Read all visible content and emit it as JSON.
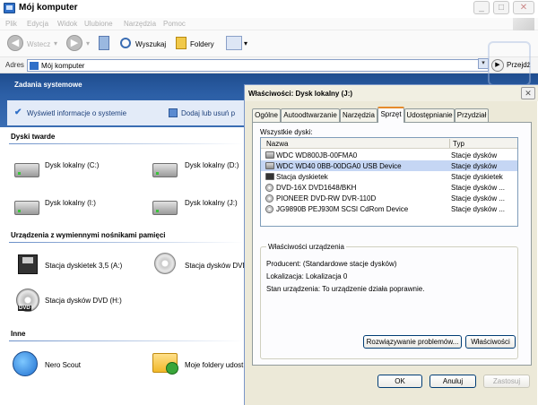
{
  "window": {
    "title": "Mój komputer"
  },
  "menu": [
    "Plik",
    "Edycja",
    "Widok",
    "Ulubione",
    "Narzędzia",
    "Pomoc"
  ],
  "toolbar": {
    "back": "Wstecz",
    "search": "Wyszukaj",
    "folders": "Foldery"
  },
  "address": {
    "label": "Adres",
    "value": "Mój komputer",
    "go": "Przejdź"
  },
  "tasks": {
    "title": "Zadania systemowe",
    "items": [
      "Wyświetl informacje o systemie",
      "Dodaj lub usuń p"
    ]
  },
  "sections": {
    "hard_disks": {
      "title": "Dyski twarde",
      "items": [
        "Dysk lokalny (C:)",
        "Dysk lokalny (D:)",
        "Dysk lokalny (I:)",
        "Dysk lokalny (J:)"
      ]
    },
    "removable": {
      "title": "Urządzenia z wymiennymi nośnikami pamięci",
      "items": [
        "Stacja dyskietek 3,5 (A:)",
        "Stacja dysków DVD",
        "Stacja dysków DVD (H:)"
      ]
    },
    "other": {
      "title": "Inne",
      "items": [
        "Nero Scout",
        "Moje foldery udost"
      ]
    }
  },
  "dialog": {
    "title": "Właściwości: Dysk lokalny (J:)",
    "tabs": [
      "Ogólne",
      "Autoodtwarzanie",
      "Narzędzia",
      "Sprzęt",
      "Udostępnianie",
      "Przydział"
    ],
    "active_tab": "Sprzęt",
    "all_disks_label": "Wszystkie dyski:",
    "columns": {
      "name": "Nazwa",
      "type": "Typ"
    },
    "disks": [
      {
        "name": "WDC WD800JB-00FMA0",
        "type": "Stacje dysków",
        "icon": "hdd"
      },
      {
        "name": "WDC WD40 0BB-00DGA0 USB Device",
        "type": "Stacje dysków",
        "icon": "hdd"
      },
      {
        "name": "Stacja dyskietek",
        "type": "Stacje dyskietek",
        "icon": "floppy"
      },
      {
        "name": "DVD-16X DVD1648/BKH",
        "type": "Stacje dysków ...",
        "icon": "cd"
      },
      {
        "name": "PIONEER DVD-RW  DVR-110D",
        "type": "Stacje dysków ...",
        "icon": "cd"
      },
      {
        "name": "JG9890B PEJ930M SCSI CdRom Device",
        "type": "Stacje dysków ...",
        "icon": "cd"
      }
    ],
    "selected_index": 1,
    "properties": {
      "legend": "Właściwości urządzenia",
      "manufacturer": "Producent: (Standardowe stacje dysków)",
      "location": "Lokalizacja: Lokalizacja 0",
      "status": "Stan urządzenia: To urządzenie działa poprawnie."
    },
    "buttons": {
      "troubleshoot": "Rozwiązywanie problemów...",
      "properties": "Właściwości",
      "ok": "OK",
      "cancel": "Anuluj",
      "apply": "Zastosuj"
    }
  }
}
